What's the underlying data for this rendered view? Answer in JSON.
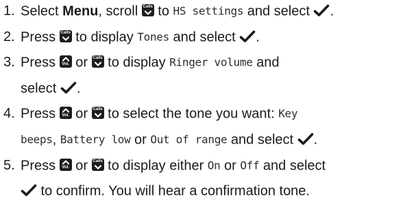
{
  "icons": {
    "calls_key_caption": "Calls",
    "vol_key_caption": "Vol.",
    "confirm": "checkmark-icon"
  },
  "steps": [
    {
      "number": "1.",
      "lines": [
        [
          {
            "t": "text",
            "v": "Select "
          },
          {
            "t": "bold",
            "v": "Menu"
          },
          {
            "t": "text",
            "v": ", scroll "
          },
          {
            "t": "calls"
          },
          {
            "t": "text",
            "v": " to "
          },
          {
            "t": "lcd",
            "v": "HS settings"
          },
          {
            "t": "text",
            "v": " and select "
          },
          {
            "t": "tick"
          },
          {
            "t": "text",
            "v": "."
          }
        ]
      ]
    },
    {
      "number": "2.",
      "lines": [
        [
          {
            "t": "text",
            "v": "Press "
          },
          {
            "t": "calls"
          },
          {
            "t": "text",
            "v": " to display "
          },
          {
            "t": "lcd",
            "v": "Tones"
          },
          {
            "t": "text",
            "v": " and select "
          },
          {
            "t": "tick"
          },
          {
            "t": "text",
            "v": "."
          }
        ]
      ]
    },
    {
      "number": "3.",
      "lines": [
        [
          {
            "t": "text",
            "v": "Press "
          },
          {
            "t": "vol"
          },
          {
            "t": "text",
            "v": " or "
          },
          {
            "t": "calls"
          },
          {
            "t": "text",
            "v": " to display "
          },
          {
            "t": "lcd",
            "v": "Ringer volume"
          },
          {
            "t": "text",
            "v": " and"
          }
        ],
        [
          {
            "t": "text",
            "v": "select "
          },
          {
            "t": "tick"
          },
          {
            "t": "text",
            "v": "."
          }
        ]
      ]
    },
    {
      "number": "4.",
      "lines": [
        [
          {
            "t": "text",
            "v": "Press "
          },
          {
            "t": "vol"
          },
          {
            "t": "text",
            "v": " or "
          },
          {
            "t": "calls"
          },
          {
            "t": "text",
            "v": " to select the tone you want: "
          },
          {
            "t": "lcd",
            "v": "Key"
          }
        ],
        [
          {
            "t": "lcd",
            "v": "beeps"
          },
          {
            "t": "text",
            "v": ", "
          },
          {
            "t": "lcd",
            "v": "Battery low"
          },
          {
            "t": "text",
            "v": " or "
          },
          {
            "t": "lcd",
            "v": "Out of range"
          },
          {
            "t": "text",
            "v": " and select "
          },
          {
            "t": "tick"
          },
          {
            "t": "text",
            "v": "."
          }
        ]
      ]
    },
    {
      "number": "5.",
      "lines": [
        [
          {
            "t": "text",
            "v": "Press "
          },
          {
            "t": "vol"
          },
          {
            "t": "text",
            "v": " or "
          },
          {
            "t": "calls"
          },
          {
            "t": "text",
            "v": " to display either "
          },
          {
            "t": "lcd",
            "v": "On"
          },
          {
            "t": "text",
            "v": " or "
          },
          {
            "t": "lcd",
            "v": "Off"
          },
          {
            "t": "text",
            "v": " and select"
          }
        ],
        [
          {
            "t": "tick"
          },
          {
            "t": "text",
            "v": " to confirm. You will hear a confirmation tone."
          }
        ]
      ]
    }
  ]
}
